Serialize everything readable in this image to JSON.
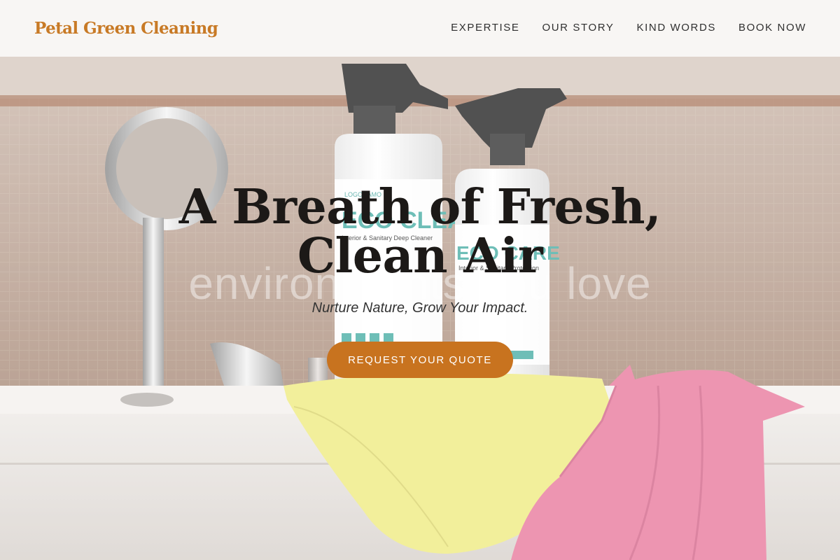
{
  "header": {
    "logo": "Petal Green Cleaning",
    "nav": [
      "EXPERTISE",
      "OUR STORY",
      "KIND WORDS",
      "BOOK NOW"
    ]
  },
  "hero": {
    "headline": "A Breath of Fresh, Clean Air",
    "ghost_text": "environments you love",
    "subtitle": "Nurture Nature, Grow Your Impact.",
    "cta_label": "REQUEST YOUR QUOTE",
    "bottle_left_label": "ECO CLEAN",
    "bottle_left_sub": "Interior & Sanitary Deep Cleaner",
    "bottle_right_label": "ECO CARE",
    "bottle_right_sub": "Interior & Sanitary Protection",
    "bottle_brand": "LOGONAMO"
  },
  "colors": {
    "brand": "#c87a26",
    "cta": "#c8731f",
    "header_bg": "#f8f6f4"
  }
}
